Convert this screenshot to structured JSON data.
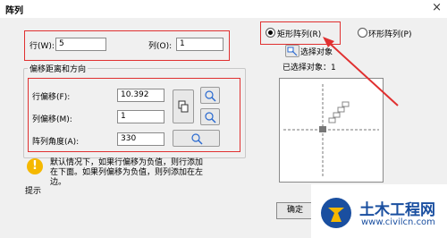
{
  "window": {
    "title": "阵列",
    "close": "×"
  },
  "rows": {
    "label": "行(W):",
    "value": "5"
  },
  "cols": {
    "label": "列(O):",
    "value": "1"
  },
  "offset_group": {
    "title": "偏移距离和方向",
    "row_offset": {
      "label": "行偏移(F):",
      "value": "10.392"
    },
    "col_offset": {
      "label": "列偏移(M):",
      "value": "1"
    },
    "angle": {
      "label": "阵列角度(A):",
      "value": "330"
    }
  },
  "mode": {
    "rect": "矩形阵列(R)",
    "polar": "环形阵列(P)",
    "selected": "rect"
  },
  "select_objects": {
    "label": "选择对象",
    "status": "已选择对象：1"
  },
  "tip": {
    "text": "默认情况下，如果行偏移为负值，则行添加在下面。如果列偏移为负值，则列添加在左边。",
    "line1": "默认情况下，如果行偏移为负值，则行添加",
    "line2": "在下面。如果列偏移为负值，则列添加在左",
    "line3": "边。",
    "caption": "提示"
  },
  "buttons": {
    "ok": "确定"
  },
  "watermark": {
    "brand": "土木工程网",
    "url": "www.civilcn.com"
  },
  "colors": {
    "highlight": "#e03030",
    "warning": "#f5b800",
    "brand_blue": "#1a4fa0"
  }
}
